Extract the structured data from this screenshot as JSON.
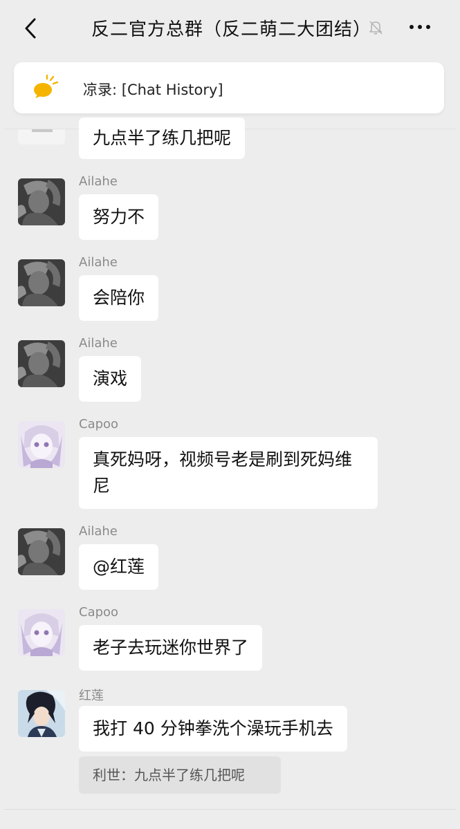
{
  "header": {
    "title": "反二官方总群（反二萌二大团结）",
    "back_icon": "chevron-left-icon",
    "mute_icon": "bell-off-icon",
    "more_icon": "more-dots-icon"
  },
  "pinned": {
    "icon": "announcement-icon",
    "text": "凉录: [Chat History]"
  },
  "messages": [
    {
      "text": "九点半了练几把呢"
    },
    {
      "sender": "Ailahe",
      "text": "努力不"
    },
    {
      "sender": "Ailahe",
      "text": "会陪你"
    },
    {
      "sender": "Ailahe",
      "text": "演戏"
    },
    {
      "sender": "Capoo",
      "text": "真死妈呀，视频号老是刷到死妈维尼"
    },
    {
      "sender": "Ailahe",
      "text": "@红莲"
    },
    {
      "sender": "Capoo",
      "text": "老子去玩迷你世界了"
    },
    {
      "sender": "红莲",
      "text": "我打 40 分钟拳洗个澡玩手机去",
      "quote": "利世：九点半了练几把呢"
    }
  ],
  "colors": {
    "background": "#ededed",
    "bubble": "#ffffff",
    "sender": "#8a8a8a",
    "quote_bg": "#e1e1e1",
    "pin_icon": "#f5b400"
  }
}
